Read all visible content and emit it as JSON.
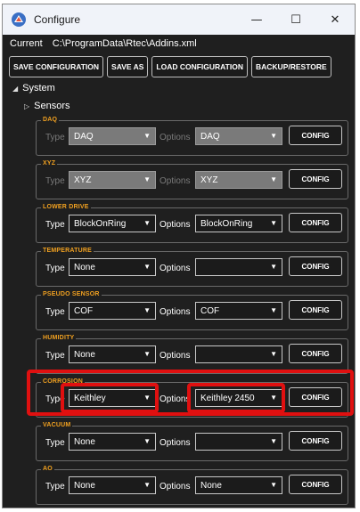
{
  "window": {
    "title": "Configure",
    "controls": {
      "minimize": "—",
      "maximize": "☐",
      "close": "✕"
    }
  },
  "current": {
    "label": "Current",
    "path": "C:\\ProgramData\\Rtec\\Addins.xml"
  },
  "toolbar": {
    "save_configuration": "SAVE CONFIGURATION",
    "save_as": "SAVE AS",
    "load_configuration": "LOAD CONFIGURATION",
    "backup_restore": "BACKUP/RESTORE"
  },
  "tree": {
    "system": "System",
    "sensors": "Sensors"
  },
  "labels": {
    "type": "Type",
    "options": "Options",
    "config": "CONFIG"
  },
  "groups": [
    {
      "title": "DAQ",
      "type": "DAQ",
      "options": "DAQ",
      "disabled": true
    },
    {
      "title": "XYZ",
      "type": "XYZ",
      "options": "XYZ",
      "disabled": true
    },
    {
      "title": "LOWER DRIVE",
      "type": "BlockOnRing",
      "options": "BlockOnRing",
      "disabled": false
    },
    {
      "title": "TEMPERATURE",
      "type": "None",
      "options": "",
      "disabled": false
    },
    {
      "title": "PSEUDO SENSOR",
      "type": "COF",
      "options": "COF",
      "disabled": false
    },
    {
      "title": "HUMIDITY",
      "type": "None",
      "options": "",
      "disabled": false
    },
    {
      "title": "CORROSION",
      "type": "Keithley",
      "options": "Keithley 2450",
      "disabled": false
    },
    {
      "title": "VACUUM",
      "type": "None",
      "options": "",
      "disabled": false
    },
    {
      "title": "AO",
      "type": "None",
      "options": "None",
      "disabled": false
    }
  ],
  "colors": {
    "background": "#1f1f1f",
    "group_title": "#f0a020",
    "highlight": "#e01010",
    "disabled_combo": "#7a7a7a"
  }
}
